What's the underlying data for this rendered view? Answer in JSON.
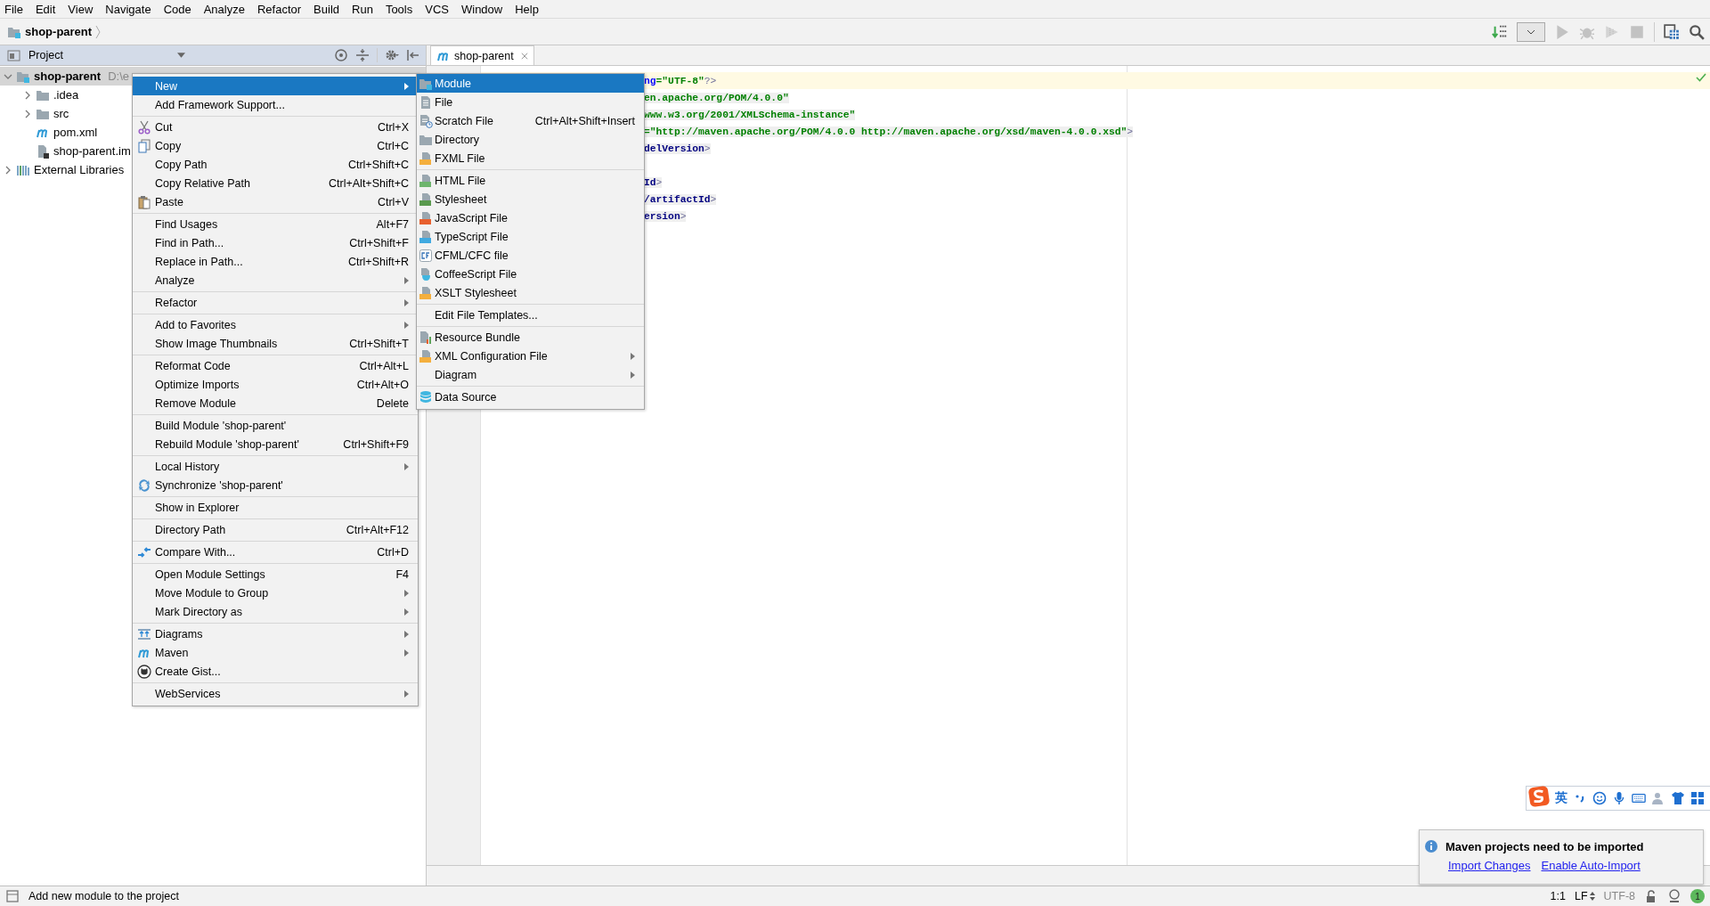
{
  "menu_bar": [
    "File",
    "Edit",
    "View",
    "Navigate",
    "Code",
    "Analyze",
    "Refactor",
    "Build",
    "Run",
    "Tools",
    "VCS",
    "Window",
    "Help"
  ],
  "navigation_bar": {
    "breadcrumb": "shop-parent"
  },
  "project_panel": {
    "title": "Project",
    "tree": [
      {
        "label": "shop-parent",
        "path": "D:\\e",
        "kind": "module",
        "selected": true,
        "expanded": true,
        "children": [
          {
            "label": ".idea",
            "kind": "folder",
            "selected": false,
            "expanded": false
          },
          {
            "label": "src",
            "kind": "folder",
            "selected": false,
            "expanded": false
          },
          {
            "label": "pom.xml",
            "kind": "maven",
            "selected": false
          },
          {
            "label": "shop-parent.im",
            "kind": "iml",
            "selected": false
          }
        ]
      },
      {
        "label": "External Libraries",
        "kind": "library",
        "selected": false,
        "expanded": false
      }
    ]
  },
  "editor": {
    "tab": {
      "label": "shop-parent",
      "selected": true
    },
    "lines": [
      {
        "current": true,
        "segments": [
          {
            "text": "ng",
            "kind": "attr"
          },
          {
            "text": "=\"UTF-8\"",
            "kind": "value"
          },
          {
            "text": "?>",
            "kind": "bracket"
          }
        ]
      },
      {
        "current": false,
        "segments": [
          {
            "text": "en.apache.org/POM/4.0.0\"",
            "kind": "value"
          }
        ]
      },
      {
        "current": false,
        "segments": [
          {
            "text": "www.w3.org/2001/XMLSchema-instance\"",
            "kind": "value"
          }
        ]
      },
      {
        "current": false,
        "segments": [
          {
            "text": "=\"http://maven.apache.org/POM/4.0.0 http://maven.apache.org/xsd/maven-4.0.0.xsd\"",
            "kind": "value"
          },
          {
            "text": ">",
            "kind": "bracket"
          }
        ]
      },
      {
        "current": false,
        "segments": [
          {
            "text": "delVersion",
            "kind": "tag"
          },
          {
            "text": ">",
            "kind": "bracket"
          }
        ]
      },
      {
        "current": false
      },
      {
        "current": false,
        "segments": [
          {
            "text": "Id",
            "kind": "tag"
          },
          {
            "text": ">",
            "kind": "bracket"
          }
        ]
      },
      {
        "current": false,
        "segments": [
          {
            "text": "/artifactId",
            "kind": "tag"
          },
          {
            "text": ">",
            "kind": "bracket"
          }
        ]
      },
      {
        "current": false,
        "segments": [
          {
            "text": "ersion",
            "kind": "tag"
          },
          {
            "text": ">",
            "kind": "bracket"
          }
        ]
      }
    ]
  },
  "context_menu": {
    "groups": [
      [
        {
          "label": "New",
          "submenu": true,
          "selected": true
        },
        {
          "label": "Add Framework Support...",
          "submenu": false,
          "selected": false
        }
      ],
      [
        {
          "label": "Cut",
          "shortcut": "Ctrl+X",
          "kind": "cut",
          "submenu": false,
          "selected": false
        },
        {
          "label": "Copy",
          "shortcut": "Ctrl+C",
          "kind": "copy",
          "submenu": false,
          "selected": false
        },
        {
          "label": "Copy Path",
          "shortcut": "Ctrl+Shift+C",
          "submenu": false,
          "selected": false
        },
        {
          "label": "Copy Relative Path",
          "shortcut": "Ctrl+Alt+Shift+C",
          "submenu": false,
          "selected": false
        },
        {
          "label": "Paste",
          "shortcut": "Ctrl+V",
          "kind": "paste",
          "submenu": false,
          "selected": false
        }
      ],
      [
        {
          "label": "Find Usages",
          "shortcut": "Alt+F7",
          "submenu": false,
          "selected": false
        },
        {
          "label": "Find in Path...",
          "shortcut": "Ctrl+Shift+F",
          "submenu": false,
          "selected": false
        },
        {
          "label": "Replace in Path...",
          "shortcut": "Ctrl+Shift+R",
          "submenu": false,
          "selected": false
        },
        {
          "label": "Analyze",
          "submenu": true,
          "selected": false
        }
      ],
      [
        {
          "label": "Refactor",
          "submenu": true,
          "selected": false
        }
      ],
      [
        {
          "label": "Add to Favorites",
          "submenu": true,
          "selected": false
        },
        {
          "label": "Show Image Thumbnails",
          "shortcut": "Ctrl+Shift+T",
          "submenu": false,
          "selected": false
        }
      ],
      [
        {
          "label": "Reformat Code",
          "shortcut": "Ctrl+Alt+L",
          "submenu": false,
          "selected": false
        },
        {
          "label": "Optimize Imports",
          "shortcut": "Ctrl+Alt+O",
          "submenu": false,
          "selected": false
        },
        {
          "label": "Remove Module",
          "shortcut": "Delete",
          "submenu": false,
          "selected": false
        }
      ],
      [
        {
          "label": "Build Module 'shop-parent'",
          "submenu": false,
          "selected": false
        },
        {
          "label": "Rebuild Module 'shop-parent'",
          "shortcut": "Ctrl+Shift+F9",
          "submenu": false,
          "selected": false
        }
      ],
      [
        {
          "label": "Local History",
          "submenu": true,
          "selected": false
        },
        {
          "label": "Synchronize 'shop-parent'",
          "kind": "sync",
          "submenu": false,
          "selected": false
        }
      ],
      [
        {
          "label": "Show in Explorer",
          "submenu": false,
          "selected": false
        }
      ],
      [
        {
          "label": "Directory Path",
          "shortcut": "Ctrl+Alt+F12",
          "submenu": false,
          "selected": false
        }
      ],
      [
        {
          "label": "Compare With...",
          "shortcut": "Ctrl+D",
          "kind": "compare",
          "submenu": false,
          "selected": false
        }
      ],
      [
        {
          "label": "Open Module Settings",
          "shortcut": "F4",
          "submenu": false,
          "selected": false
        },
        {
          "label": "Move Module to Group",
          "submenu": true,
          "selected": false
        },
        {
          "label": "Mark Directory as",
          "submenu": true,
          "selected": false
        }
      ],
      [
        {
          "label": "Diagrams",
          "kind": "diagrams",
          "submenu": true,
          "selected": false
        },
        {
          "label": "Maven",
          "kind": "maven",
          "submenu": true,
          "selected": false
        },
        {
          "label": "Create Gist...",
          "kind": "gist",
          "submenu": false,
          "selected": false
        }
      ],
      [
        {
          "label": "WebServices",
          "submenu": true,
          "selected": false
        }
      ]
    ]
  },
  "new_submenu": {
    "groups": [
      [
        {
          "label": "Module",
          "kind": "module",
          "submenu": false,
          "selected": true
        },
        {
          "label": "File",
          "kind": "file",
          "submenu": false,
          "selected": false
        },
        {
          "label": "Scratch File",
          "shortcut": "Ctrl+Alt+Shift+Insert",
          "kind": "scratch",
          "submenu": false,
          "selected": false
        },
        {
          "label": "Directory",
          "kind": "folder",
          "submenu": false,
          "selected": false
        },
        {
          "label": "FXML File",
          "kind": "xml",
          "submenu": false,
          "selected": false
        }
      ],
      [
        {
          "label": "HTML File",
          "kind": "html",
          "submenu": false,
          "selected": false
        },
        {
          "label": "Stylesheet",
          "kind": "css",
          "submenu": false,
          "selected": false
        },
        {
          "label": "JavaScript File",
          "kind": "js",
          "submenu": false,
          "selected": false
        },
        {
          "label": "TypeScript File",
          "kind": "ts",
          "submenu": false,
          "selected": false
        },
        {
          "label": "CFML/CFC file",
          "kind": "cf",
          "submenu": false,
          "selected": false
        },
        {
          "label": "CoffeeScript File",
          "kind": "coffee",
          "submenu": false,
          "selected": false
        },
        {
          "label": "XSLT Stylesheet",
          "kind": "xml",
          "submenu": false,
          "selected": false
        }
      ],
      [
        {
          "label": "Edit File Templates...",
          "submenu": false,
          "selected": false
        }
      ],
      [
        {
          "label": "Resource Bundle",
          "kind": "bundle",
          "submenu": false,
          "selected": false
        },
        {
          "label": "XML Configuration File",
          "kind": "xml",
          "submenu": true,
          "selected": false
        },
        {
          "label": "Diagram",
          "submenu": true,
          "selected": false
        }
      ],
      [
        {
          "label": "Data Source",
          "kind": "database",
          "submenu": false,
          "selected": false
        }
      ]
    ]
  },
  "ime_bar": {
    "mode": "英"
  },
  "notification": {
    "title": "Maven projects need to be imported",
    "links": [
      "Import Changes",
      "Enable Auto-Import"
    ]
  },
  "status_bar": {
    "message": "Add new module to the project",
    "position": "1:1",
    "line_separator": "LF",
    "encoding": "UTF-8",
    "notifications": "1"
  }
}
